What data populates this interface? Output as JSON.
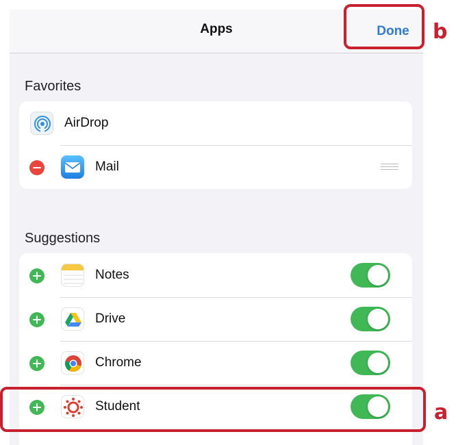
{
  "nav": {
    "title": "Apps",
    "done_label": "Done"
  },
  "favorites": {
    "header": "Favorites",
    "items": [
      {
        "label": "AirDrop",
        "icon": "airdrop-icon"
      },
      {
        "label": "Mail",
        "icon": "mail-icon",
        "action": "remove"
      }
    ]
  },
  "suggestions": {
    "header": "Suggestions",
    "items": [
      {
        "label": "Notes",
        "icon": "notes-icon",
        "enabled": true
      },
      {
        "label": "Drive",
        "icon": "drive-icon",
        "enabled": true
      },
      {
        "label": "Chrome",
        "icon": "chrome-icon",
        "enabled": true
      },
      {
        "label": "Student",
        "icon": "canvas-student-icon",
        "enabled": true
      }
    ]
  },
  "annotations": {
    "a": "a",
    "b": "b"
  },
  "colors": {
    "accent": "#2f7bd3",
    "toggle_on": "#3fb855",
    "remove": "#e8453c",
    "highlight": "#c8202f"
  }
}
